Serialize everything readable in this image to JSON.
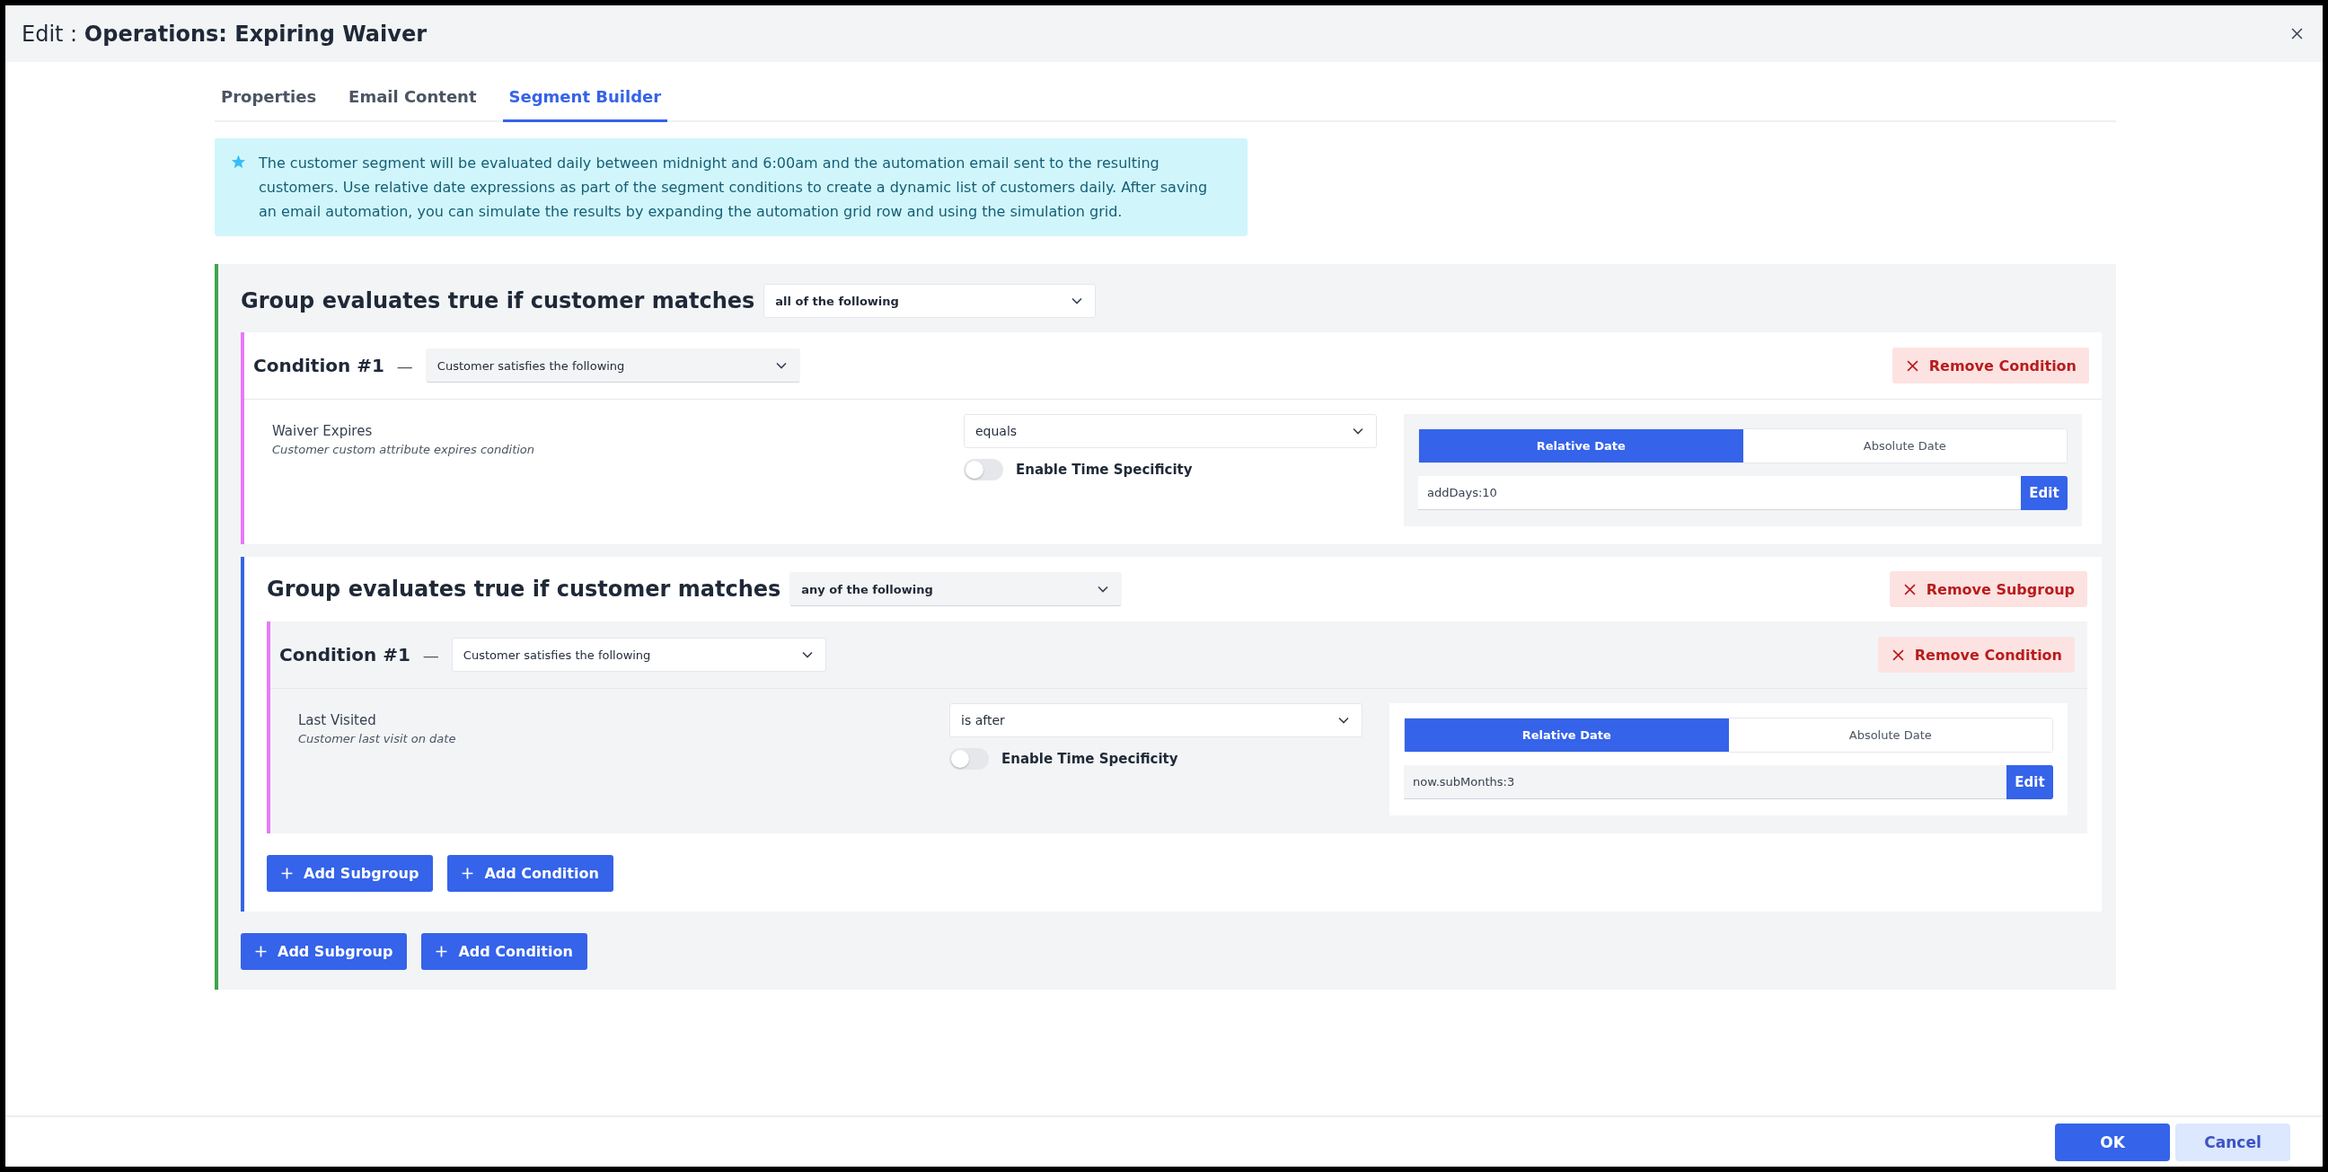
{
  "dialog": {
    "title_prefix": "Edit :",
    "title": "Operations: Expiring Waiver"
  },
  "tabs": [
    {
      "label": "Properties",
      "selected": false
    },
    {
      "label": "Email Content",
      "selected": false
    },
    {
      "label": "Segment Builder",
      "selected": true
    }
  ],
  "info": {
    "text": "The customer segment will be evaluated daily between midnight and 6:00am and the automation email sent to the resulting customers. Use relative date expressions as part of the segment conditions to create a dynamic list of customers daily. After saving an email automation, you can simulate the results by expanding the automation grid row and using the simulation grid."
  },
  "group": {
    "label": "Group evaluates true if customer matches",
    "match": "all of the following",
    "items": [
      {
        "kind": "condition",
        "title": "Condition #1",
        "dash": "—",
        "type": "Customer satisfies the following",
        "remove": "Remove Condition",
        "attribute": "Waiver Expires",
        "description": "Customer custom attribute expires condition",
        "operator": "equals",
        "time_specificity": {
          "label": "Enable Time Specificity",
          "on": false
        },
        "date_modes": [
          {
            "label": "Relative Date",
            "selected": true
          },
          {
            "label": "Absolute Date",
            "selected": false
          }
        ],
        "value": "addDays:10",
        "edit": "Edit"
      },
      {
        "kind": "subgroup",
        "label": "Group evaluates true if customer matches",
        "match": "any of the following",
        "remove": "Remove Subgroup",
        "items": [
          {
            "kind": "condition",
            "title": "Condition #1",
            "dash": "—",
            "type": "Customer satisfies the following",
            "remove": "Remove Condition",
            "attribute": "Last Visited",
            "description": "Customer last visit on date",
            "operator": "is after",
            "time_specificity": {
              "label": "Enable Time Specificity",
              "on": false
            },
            "date_modes": [
              {
                "label": "Relative Date",
                "selected": true
              },
              {
                "label": "Absolute Date",
                "selected": false
              }
            ],
            "value": "now.subMonths:3",
            "edit": "Edit"
          }
        ],
        "add_buttons": [
          "Add Subgroup",
          "Add Condition"
        ]
      }
    ],
    "add_buttons": [
      "Add Subgroup",
      "Add Condition"
    ]
  },
  "footer": {
    "buttons": [
      {
        "label": "OK",
        "kind": "primary"
      },
      {
        "label": "Cancel",
        "kind": "secondary"
      }
    ]
  }
}
